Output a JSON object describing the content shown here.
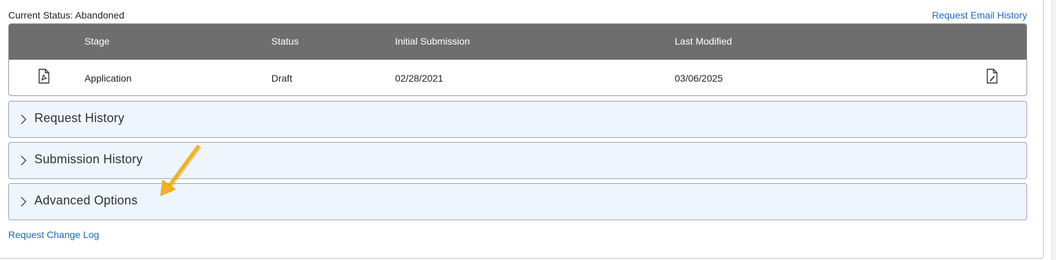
{
  "header": {
    "current_status": "Current Status: Abandoned",
    "email_history_link": "Request Email History"
  },
  "table": {
    "columns": [
      "Stage",
      "Status",
      "Initial Submission",
      "Last Modified"
    ],
    "rows": [
      {
        "stage": "Application",
        "status": "Draft",
        "initial_submission": "02/28/2021",
        "last_modified": "03/06/2025",
        "leading_icon": "pdf-file-icon",
        "trailing_icon": "edit-document-icon"
      }
    ]
  },
  "sections": [
    {
      "label": "Request History",
      "icon": "chevron-right-icon",
      "expanded": false
    },
    {
      "label": "Submission History",
      "icon": "chevron-right-icon",
      "expanded": false
    },
    {
      "label": "Advanced Options",
      "icon": "chevron-right-icon",
      "expanded": false
    }
  ],
  "footer": {
    "change_log_link": "Request Change Log"
  },
  "annotation": {
    "icon": "pointer-arrow-icon",
    "color": "#f2b21e"
  },
  "colors": {
    "table_header_bg": "#6e6e6e",
    "accordion_bg": "#eef5fd",
    "link": "#1a6ac0"
  }
}
